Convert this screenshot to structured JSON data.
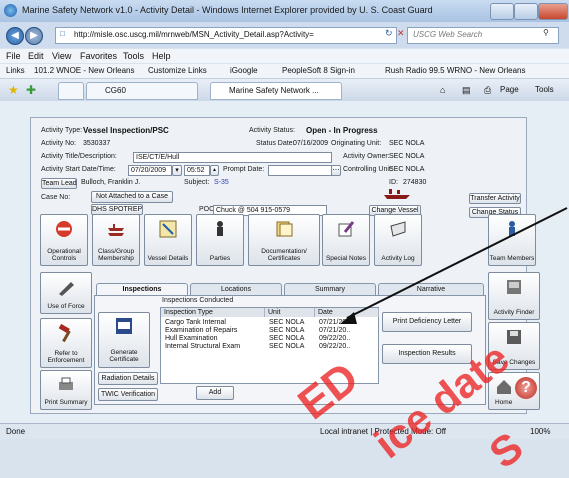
{
  "window": {
    "title": "Marine Safety Network v1.0 - Activity Detail - Windows Internet Explorer provided by U. S. Coast Guard",
    "url": "http://misle.osc.uscg.mil/mrnweb/MSN_Activity_Detail.asp?Activity=",
    "search_placeholder": "USCG Web Search"
  },
  "menu": [
    "File",
    "Edit",
    "View",
    "Favorites",
    "Tools",
    "Help"
  ],
  "links": {
    "label": "Links",
    "items": [
      "101.2 WNOE - New Orleans",
      "Customize Links",
      "iGoogle",
      "PeopleSoft 8 Sign-in",
      "Rush Radio 99.5 WRNO - New Orleans"
    ]
  },
  "browser_tabs": [
    "CG60",
    "Marine Safety Network ..."
  ],
  "toolbar": {
    "page": "Page",
    "tools": "Tools"
  },
  "activity": {
    "type_label": "Activity Type:",
    "type_value": "Vessel Inspection/PSC",
    "status_label": "Activity Status:",
    "status_value": "Open - In Progress",
    "no_label": "Activity No:",
    "no_value": "3530337",
    "status_date_label": "Status Date:",
    "status_date_value": "07/16/2009",
    "orig_unit_label": "Originating Unit:",
    "orig_unit_value": "SEC NOLA",
    "title_label": "Activity Title/Description:",
    "title_value": "ISE/CT/E/Hull",
    "owner_label": "Activity Owner:",
    "owner_value": "SEC NOLA",
    "start_label": "Activity Start Date/Time:",
    "start_date": "07/20/2009",
    "start_time": "05:52",
    "prompt_label": "Prompt Date:",
    "ctrl_unit_label": "Controlling Unit:",
    "ctrl_unit_value": "SEC NOLA",
    "team_lead_button": "Team Lead",
    "team_lead_value": "Bulloch, Franklin J.",
    "subject_label": "Subject:",
    "subject_value": "S-35",
    "id_label": "ID:",
    "id_value": "274830",
    "case_label": "Case No:",
    "not_attached_button": "Not Attached to a Case",
    "dhs_button": "DHS SPOTREP",
    "poc_label": "POC",
    "poc_value": "Chuck @ 504 915-0579",
    "transfer_button": "Transfer Activity",
    "change_vessel_button": "Change Vessel",
    "change_status_button": "Change Status"
  },
  "icon_buttons": [
    {
      "label": "Operational Controls",
      "icon": "no-entry-icon"
    },
    {
      "label": "Class/Group Membership",
      "icon": "ships-icon"
    },
    {
      "label": "Vessel Details",
      "icon": "vessel-details-icon"
    },
    {
      "label": "Parties",
      "icon": "person-icon"
    },
    {
      "label": "Documentation/ Certificates",
      "icon": "documents-icon"
    },
    {
      "label": "Special Notes",
      "icon": "pen-note-icon"
    },
    {
      "label": "Activity Log",
      "icon": "activity-log-icon"
    },
    {
      "label": "Team Members",
      "icon": "team-icon"
    }
  ],
  "left_buttons": [
    {
      "label": "Use of Force",
      "icon": "use-of-force-icon"
    },
    {
      "label": "Refer to Enforcement",
      "icon": "hammer-icon"
    },
    {
      "label": "Print Summary",
      "icon": "printer-icon"
    }
  ],
  "right_buttons": [
    {
      "label": "Activity Finder",
      "icon": "finder-icon"
    },
    {
      "label": "Save Changes",
      "icon": "save-icon"
    },
    {
      "label": "Home",
      "icon": "home-icon"
    }
  ],
  "tabs": [
    "Inspections",
    "Locations",
    "Summary",
    "Narrative"
  ],
  "inspections": {
    "conducted_label": "Inspections Conducted",
    "columns": [
      "Inspection Type",
      "Unit",
      "Date"
    ],
    "rows": [
      [
        "Cargo Tank Internal",
        "SEC NOLA",
        "07/21/20.."
      ],
      [
        "Examination of Repairs",
        "SEC NOLA",
        "07/21/20.."
      ],
      [
        "Hull Examination",
        "SEC NOLA",
        "09/22/20.."
      ],
      [
        "Internal Structural Exam",
        "SEC NOLA",
        "09/22/20.."
      ]
    ],
    "generate_cert_button": "Generate Certificate",
    "print_deficiency_button": "Print Deficiency Letter",
    "inspection_results_button": "Inspection Results",
    "add_button": "Add",
    "radiation_button": "Radiation Details",
    "twic_button": "TWIC Verification"
  },
  "status_bar": {
    "left": "Done",
    "zone": "Local intranet | Protected Mode: Off",
    "zoom": "100%"
  },
  "watermark": {
    "lines": [
      "ED",
      "ice date",
      "S"
    ]
  },
  "help_icon": "?"
}
